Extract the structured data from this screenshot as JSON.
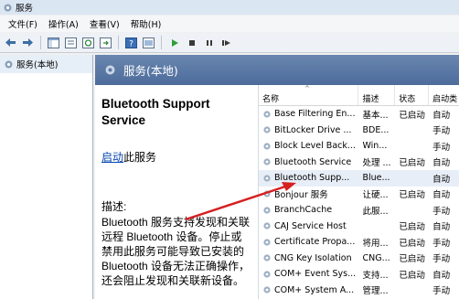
{
  "window": {
    "title": "服务"
  },
  "menu": [
    {
      "label": "文件(F)"
    },
    {
      "label": "操作(A)"
    },
    {
      "label": "查看(V)"
    },
    {
      "label": "帮助(H)"
    }
  ],
  "toolbar": {
    "buttons": [
      "back-arrow-icon",
      "forward-arrow-icon",
      "console-tree-icon",
      "properties-icon",
      "refresh-icon",
      "export-icon",
      "help-icon",
      "show-hide-icon",
      "play-icon",
      "stop-icon",
      "pause-icon",
      "resume-icon"
    ]
  },
  "tree": {
    "root": "服务(本地)"
  },
  "header": {
    "title": "服务(本地)"
  },
  "detail": {
    "service_name": "Bluetooth Support Service",
    "start_link": "启动",
    "start_suffix": "此服务",
    "desc_label": "描述:",
    "desc_text": "Bluetooth 服务支持发现和关联远程 Bluetooth 设备。停止或禁用此服务可能导致已安装的 Bluetooth 设备无法正确操作，还会阻止发现和关联新设备。"
  },
  "columns": [
    {
      "label": "名称"
    },
    {
      "label": "描述"
    },
    {
      "label": "状态"
    },
    {
      "label": "启动类"
    }
  ],
  "services": [
    {
      "name": "Base Filtering En...",
      "desc": "基本...",
      "status": "已启动",
      "startup": "自动"
    },
    {
      "name": "BitLocker Drive ...",
      "desc": "BDE...",
      "status": "",
      "startup": "手动"
    },
    {
      "name": "Block Level Back...",
      "desc": "Win...",
      "status": "",
      "startup": "手动"
    },
    {
      "name": "Bluetooth Service",
      "desc": "处理 ...",
      "status": "已启动",
      "startup": "自动"
    },
    {
      "name": "Bluetooth Supp...",
      "desc": "Blue...",
      "status": "",
      "startup": "自动"
    },
    {
      "name": "Bonjour 服务",
      "desc": "让硬...",
      "status": "已启动",
      "startup": "自动"
    },
    {
      "name": "BranchCache",
      "desc": "此服...",
      "status": "",
      "startup": "手动"
    },
    {
      "name": "CAJ Service Host",
      "desc": "",
      "status": "已启动",
      "startup": "自动"
    },
    {
      "name": "Certificate Propa...",
      "desc": "将用...",
      "status": "已启动",
      "startup": "手动"
    },
    {
      "name": "CNG Key Isolation",
      "desc": "CNG...",
      "status": "已启动",
      "startup": "手动"
    },
    {
      "name": "COM+ Event Sys...",
      "desc": "支持...",
      "status": "已启动",
      "startup": "自动"
    },
    {
      "name": "COM+ System A...",
      "desc": "管理...",
      "status": "",
      "startup": "手动"
    }
  ],
  "selected_index": 4,
  "colors": {
    "header_band": "#5a78a6",
    "link": "#0645ad",
    "annotation_arrow": "#d62020"
  }
}
